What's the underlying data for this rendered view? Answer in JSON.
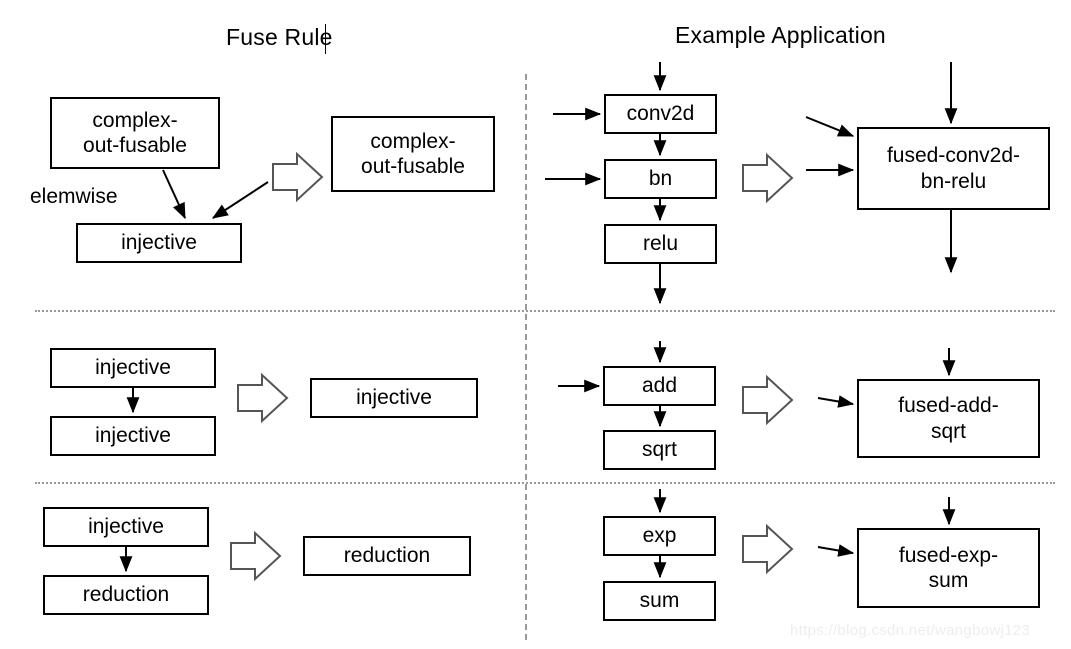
{
  "headers": {
    "left_title": "Fuse Rule",
    "right_title": "Example Application"
  },
  "rows": [
    {
      "id": "row-1",
      "rule": {
        "source_boxes": [
          {
            "name": "complex-out-fusable-box",
            "text": "complex-\nout-fusable"
          },
          {
            "name": "injective-box",
            "text": "injective"
          }
        ],
        "edge_label": "elemwise",
        "result_box": {
          "name": "complex-out-fusable-result-box",
          "text": "complex-\nout-fusable"
        }
      },
      "example": {
        "source_boxes": [
          {
            "name": "conv2d-box",
            "text": "conv2d"
          },
          {
            "name": "bn-box",
            "text": "bn"
          },
          {
            "name": "relu-box",
            "text": "relu"
          }
        ],
        "result_box": {
          "name": "fused-conv2d-bn-relu-box",
          "text": "fused-conv2d-\nbn-relu"
        }
      }
    },
    {
      "id": "row-2",
      "rule": {
        "source_boxes": [
          {
            "name": "injective-box-top",
            "text": "injective"
          },
          {
            "name": "injective-box-bottom",
            "text": "injective"
          }
        ],
        "edge_label": "",
        "result_box": {
          "name": "injective-result-box",
          "text": "injective"
        }
      },
      "example": {
        "source_boxes": [
          {
            "name": "add-box",
            "text": "add"
          },
          {
            "name": "sqrt-box",
            "text": "sqrt"
          }
        ],
        "result_box": {
          "name": "fused-add-sqrt-box",
          "text": "fused-add-\nsqrt"
        }
      }
    },
    {
      "id": "row-3",
      "rule": {
        "source_boxes": [
          {
            "name": "injective-box",
            "text": "injective"
          },
          {
            "name": "reduction-box",
            "text": "reduction"
          }
        ],
        "edge_label": "",
        "result_box": {
          "name": "reduction-result-box",
          "text": "reduction"
        }
      },
      "example": {
        "source_boxes": [
          {
            "name": "exp-box",
            "text": "exp"
          },
          {
            "name": "sum-box",
            "text": "sum"
          }
        ],
        "result_box": {
          "name": "fused-exp-sum-box",
          "text": "fused-exp-\nsum"
        }
      }
    }
  ],
  "watermark": "https://blog.csdn.net/wangbowj123",
  "colors": {
    "stroke": "#000000",
    "divider": "#9a9a9a",
    "background": "#ffffff",
    "watermark": "#ededed"
  }
}
